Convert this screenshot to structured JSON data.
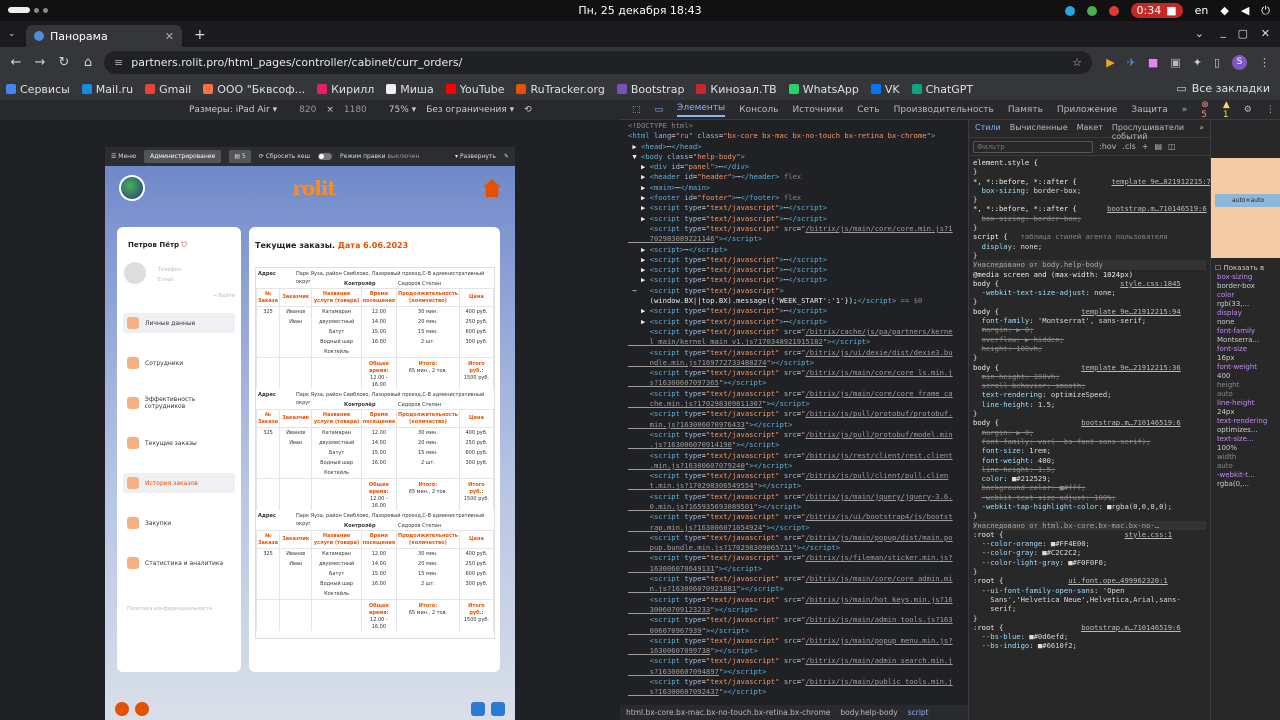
{
  "system": {
    "datetime": "Пн, 25 декабря  18:43",
    "record_time": "0:34",
    "lang": "en"
  },
  "tab": {
    "title": "Панорама"
  },
  "address": {
    "url": "partners.rolit.pro/html_pages/controller/cabinet/curr_orders/"
  },
  "bookmarks": {
    "items": [
      "Сервисы",
      "Mail.ru",
      "Gmail",
      "ООО \"Бквсоф...",
      "Кирилл",
      "Миша",
      "YouTube",
      "RuTracker.org",
      "Bootstrap",
      "Кинозал.ТВ",
      "WhatsApp",
      "VK",
      "ChatGPT"
    ],
    "colors": [
      "#4285f4",
      "#168de2",
      "#ea4335",
      "#ff7043",
      "#e91e63",
      "#eeeeee",
      "#ff0000",
      "#e65100",
      "#7952b3",
      "#c62828",
      "#25d366",
      "#0077ff",
      "#10a37f"
    ],
    "all": "Все закладки"
  },
  "devbar": {
    "size_label": "Размеры: iPad Air",
    "width": "820",
    "height": "1180",
    "zoom": "75%",
    "throttle": "Без ограничения"
  },
  "site": {
    "toolbar": {
      "menu": "Меню",
      "admin": "Администрирование",
      "count": "5",
      "reset_cache": "Сбросить кеш",
      "edit_mode": "Режим правки",
      "edit_state": "выключен",
      "expand": "Развернуть"
    },
    "logo": "rolit",
    "profile": {
      "name": "Петров Пётр",
      "phone": "Телефон",
      "email": "E-mail",
      "exit": "Выйти"
    },
    "menu": [
      {
        "label": "Личные данные"
      },
      {
        "label": "Сотрудники"
      },
      {
        "label": "Эффективность сотрудников"
      },
      {
        "label": "Текущие заказы"
      },
      {
        "label": "История заказов"
      },
      {
        "label": "Закупки"
      },
      {
        "label": "Статистика и аналитика"
      }
    ],
    "policy": "Политика конфиденциальности",
    "title": "Текущие заказы.",
    "date_prefix": "Дата",
    "date": "6.06.2023",
    "order_headers": [
      "№ Заказа",
      "Заказчик",
      "Название услуги (товара)",
      "Время посещения",
      "Продолжительность (количество)",
      "Цена"
    ],
    "address_label": "Адрес",
    "address_value": "Парк Яуза, район Свиблово, Лазоревый проезд,С-В административный округ",
    "controller_label": "Контролёр",
    "controller_value": "Сидоров Степан",
    "orders": [
      {
        "num": "325",
        "client": "Иванов Иван",
        "services": [
          "Катамаран двухместный",
          "Батут",
          "Водный шар",
          "Коктейль"
        ],
        "times": [
          "12.00",
          "14.00",
          "15.00",
          "16.00"
        ],
        "durations": [
          "30 мин.",
          "20 мин.",
          "15 мин.",
          "2 шт."
        ],
        "prices": [
          "400 руб.",
          "250 руб.",
          "600 руб.",
          "300 руб."
        ],
        "total_time_label": "Общее время:",
        "total_time": "12.00 - 16.00",
        "total_label": "Итого:",
        "total_dur": "65 мин., 2 тов.",
        "total_price_label": "Итого руб.:",
        "total_price": "1500 руб."
      },
      {
        "num": "325",
        "client": "Иванов Иван",
        "services": [
          "Катамаран двухместный",
          "Батут",
          "Водный шар",
          "Коктейль"
        ],
        "times": [
          "12.00",
          "14.00",
          "15.00",
          "16.00"
        ],
        "durations": [
          "30 мин.",
          "20 мин.",
          "15 мин.",
          "2 шт."
        ],
        "prices": [
          "400 руб.",
          "250 руб.",
          "600 руб.",
          "300 руб."
        ],
        "total_time_label": "Общее время:",
        "total_time": "12.00 - 16.00",
        "total_label": "Итого:",
        "total_dur": "65 мин., 2 тов.",
        "total_price_label": "Итого руб.:",
        "total_price": "1500 руб."
      },
      {
        "num": "325",
        "client": "Иванов Иван",
        "services": [
          "Катамаран двухместный",
          "Батут",
          "Водный шар",
          "Коктейль"
        ],
        "times": [
          "12.00",
          "14.00",
          "15.00",
          "16.00"
        ],
        "durations": [
          "30 мин.",
          "20 мин.",
          "15 мин.",
          "2 шт."
        ],
        "prices": [
          "400 руб.",
          "250 руб.",
          "600 руб.",
          "300 руб."
        ],
        "total_time_label": "Общее время:",
        "total_time": "12.00 - 16.00",
        "total_label": "Итого:",
        "total_dur": "65 мин., 2 тов.",
        "total_price_label": "Итого руб.:",
        "total_price": "1500 руб."
      }
    ]
  },
  "devtools": {
    "tabs": [
      "Элементы",
      "Консоль",
      "Источники",
      "Сеть",
      "Производительность",
      "Память",
      "Приложение",
      "Защита"
    ],
    "errors": "5",
    "warnings": "1",
    "crumbs": [
      "html.bx-core.bx-mac.bx-no-touch.bx-retina.bx-chrome",
      "body.help-body",
      "script"
    ],
    "styles_tabs": [
      "Стили",
      "Вычисленные",
      "Макет",
      "Прослушиватели событий"
    ],
    "filter_placeholder": "Фильтр",
    "hov": ":hov",
    "cls": ".cls",
    "computed_show_all": "Показать в",
    "box_value": "auto×auto"
  }
}
